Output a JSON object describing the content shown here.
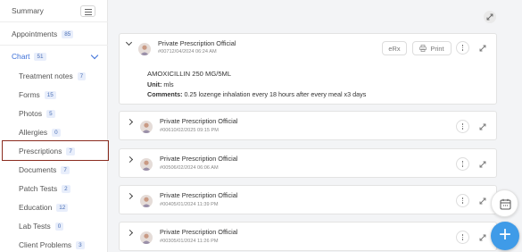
{
  "sidebar": {
    "summary": "Summary",
    "appointments": {
      "label": "Appointments",
      "count": "85"
    },
    "chart": {
      "label": "Chart",
      "count": "51"
    },
    "items": [
      {
        "label": "Treatment notes",
        "count": "7"
      },
      {
        "label": "Forms",
        "count": "15"
      },
      {
        "label": "Photos",
        "count": "5"
      },
      {
        "label": "Allergies",
        "count": "0"
      },
      {
        "label": "Prescriptions",
        "count": "7"
      },
      {
        "label": "Documents",
        "count": "7"
      },
      {
        "label": "Patch Tests",
        "count": "2"
      },
      {
        "label": "Education",
        "count": "12"
      },
      {
        "label": "Lab Tests",
        "count": "0"
      },
      {
        "label": "Client Problems",
        "count": "3"
      }
    ]
  },
  "prescriptions": [
    {
      "title": "Private Prescription Official",
      "sub": "#00712/04/2024 06:24 AM",
      "expanded": true,
      "ehr_label": "eRx",
      "print_label": "Print",
      "drug": "AMOXICILLIN 250 MG/5ML",
      "unit_label": "Unit:",
      "unit_value": "mls",
      "comments_label": "Comments:",
      "comments_value": "0.25 lozenge inhalation every 18 hours after every meal x3 days"
    },
    {
      "title": "Private Prescription Official",
      "sub": "#00610/02/2025 09:15 PM"
    },
    {
      "title": "Private Prescription Official",
      "sub": "#00506/02/2024 06:06 AM"
    },
    {
      "title": "Private Prescription Official",
      "sub": "#00405/01/2024 11:39 PM"
    },
    {
      "title": "Private Prescription Official",
      "sub": "#00305/01/2024 11:26 PM"
    }
  ],
  "fab_label": "+",
  "colors": {
    "accent": "#3b6fd8",
    "fab": "#3f9be8",
    "highlight": "#8b2c1f"
  }
}
